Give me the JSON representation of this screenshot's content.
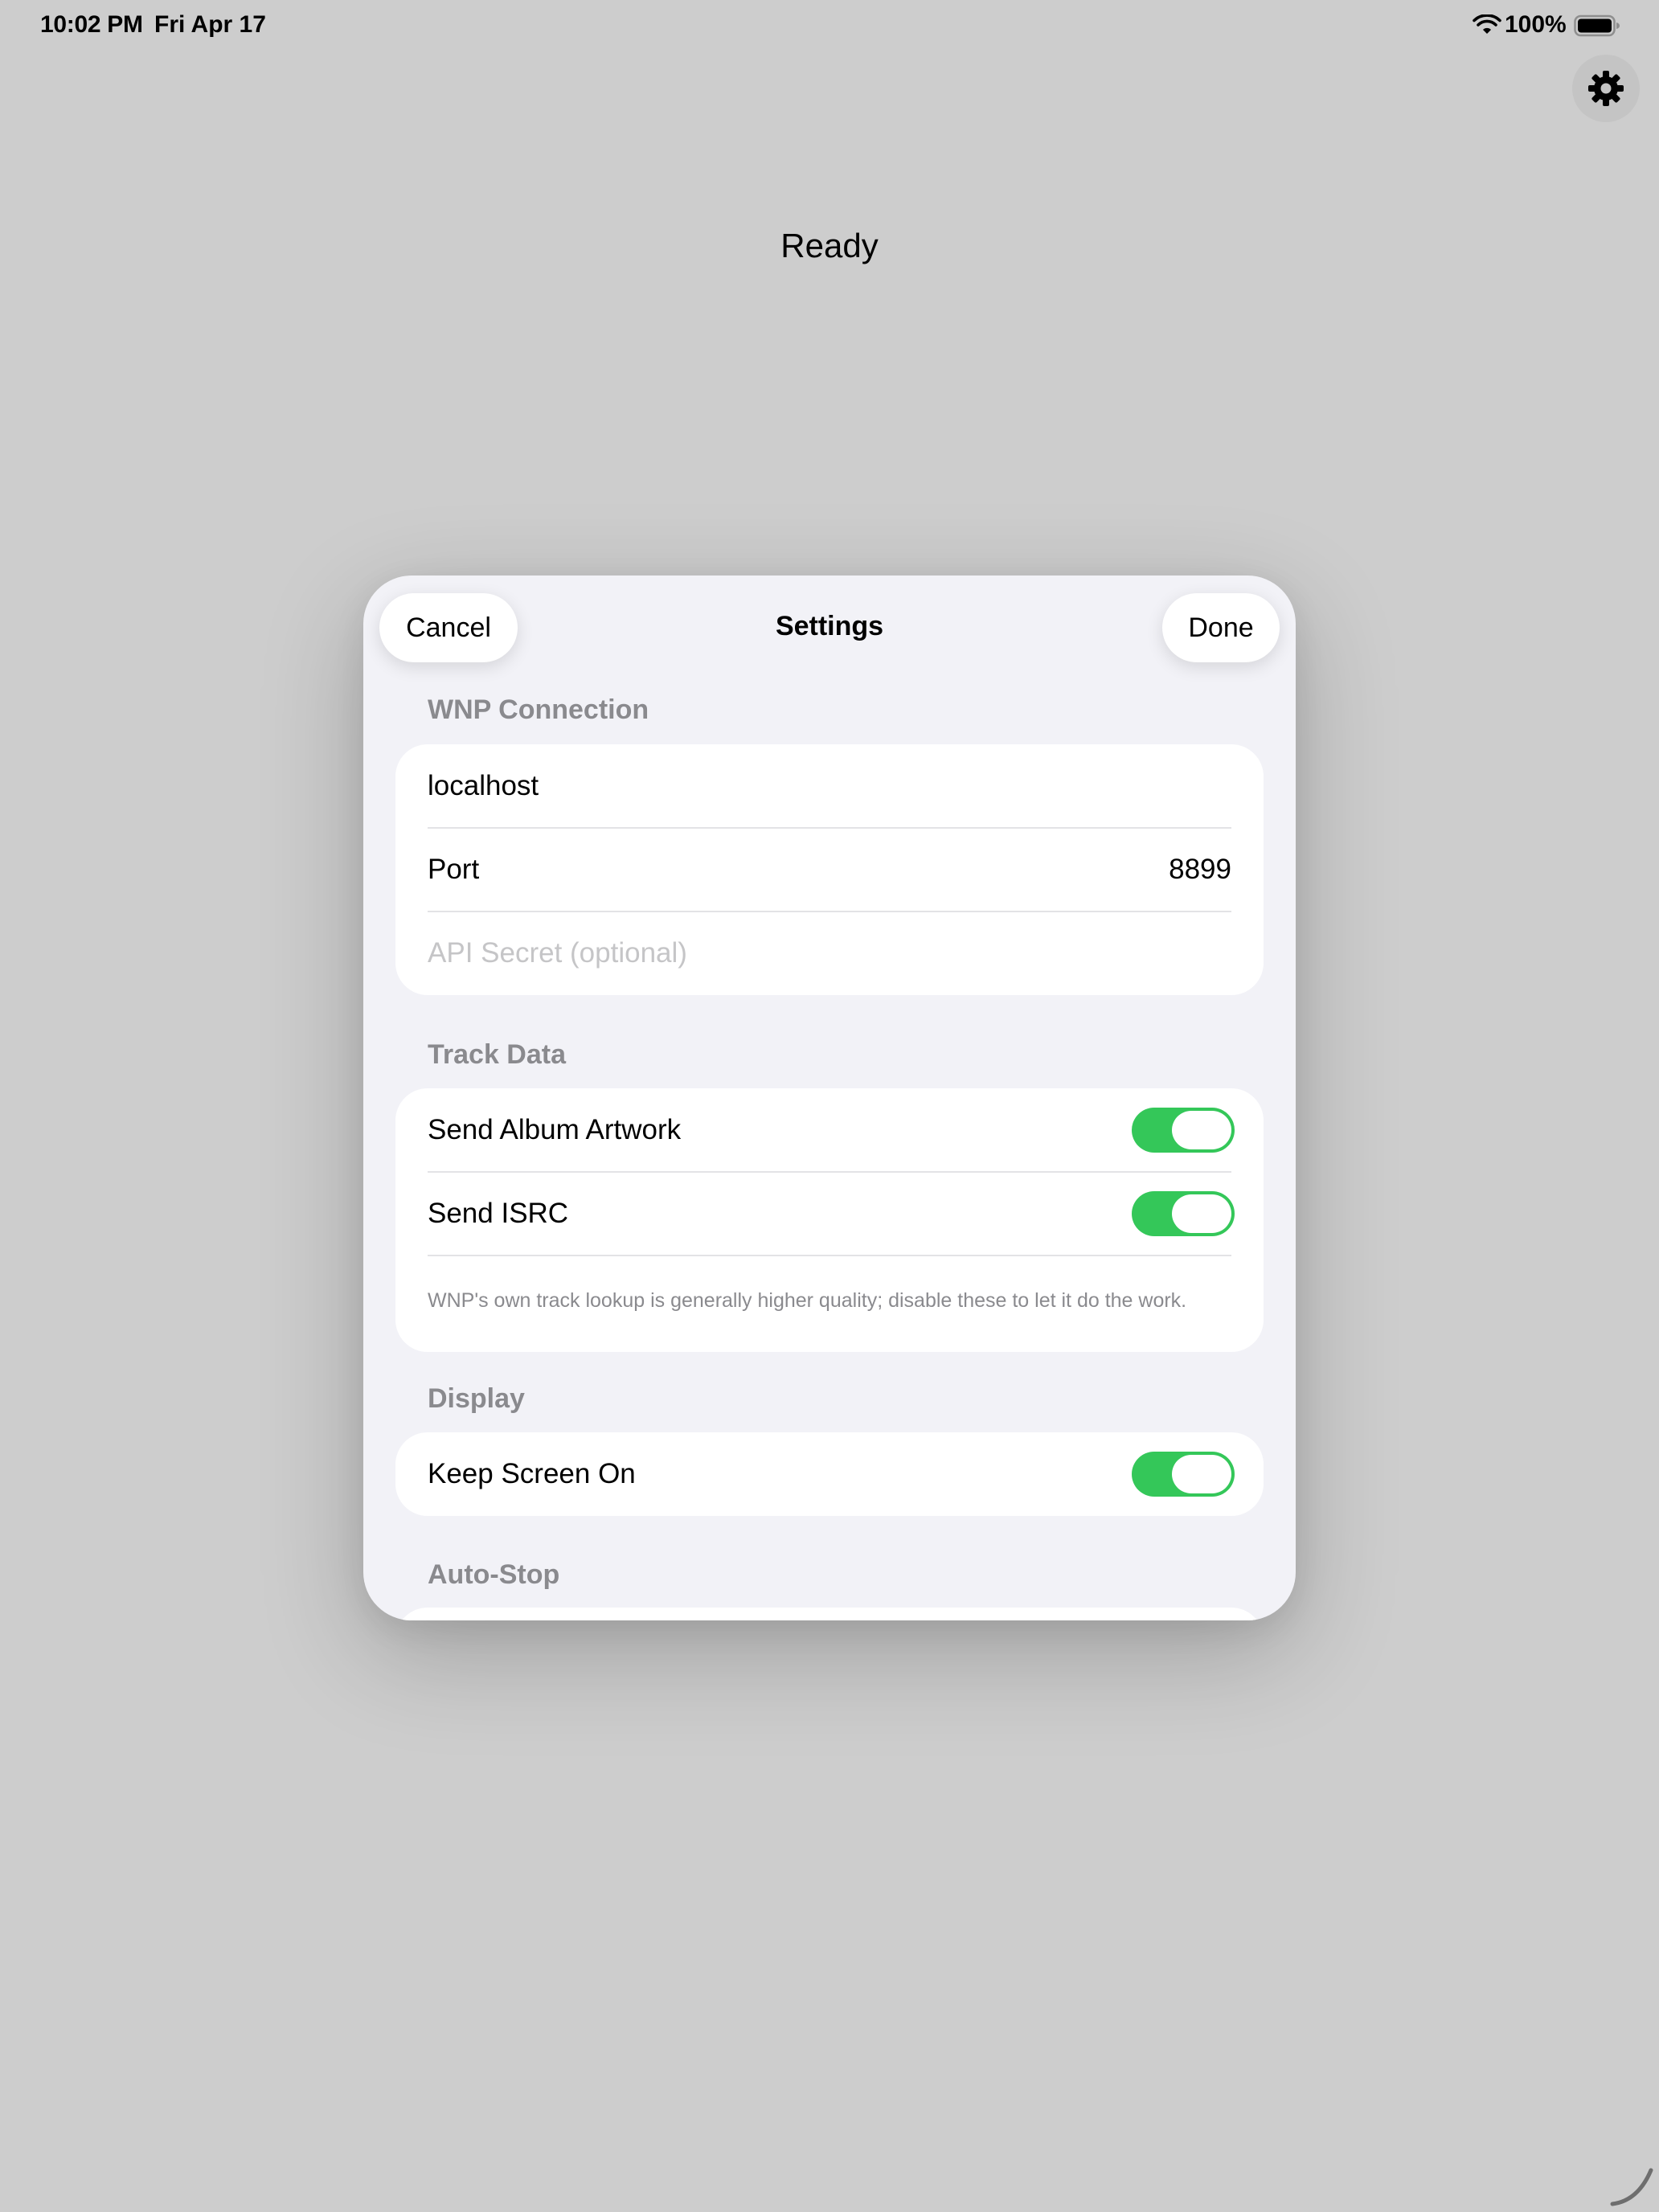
{
  "status_bar": {
    "time": "10:02 PM",
    "date": "Fri Apr 17",
    "battery": "100%",
    "icons": [
      "wifi-icon",
      "battery-icon"
    ]
  },
  "background": {
    "status_text": "Ready",
    "settings_icon": "gear-icon"
  },
  "sheet": {
    "title": "Settings",
    "cancel_label": "Cancel",
    "done_label": "Done",
    "sections": {
      "wnp": {
        "header": "WNP Connection",
        "host_value": "localhost",
        "port_label": "Port",
        "port_value": "8899",
        "secret_placeholder": "API Secret (optional)"
      },
      "track": {
        "header": "Track Data",
        "artwork_label": "Send Album Artwork",
        "artwork_on": true,
        "isrc_label": "Send ISRC",
        "isrc_on": true,
        "footnote": "WNP's own track lookup is generally higher quality; disable these to let it do the work."
      },
      "display": {
        "header": "Display",
        "keep_screen_label": "Keep Screen On",
        "keep_screen_on": true
      },
      "autostop": {
        "header": "Auto-Stop"
      }
    }
  },
  "colors": {
    "toggle_on": "#34c759",
    "sheet_bg": "#f2f2f7",
    "backdrop": "#cdcdcd",
    "secondary_text": "#8a8a8e"
  }
}
